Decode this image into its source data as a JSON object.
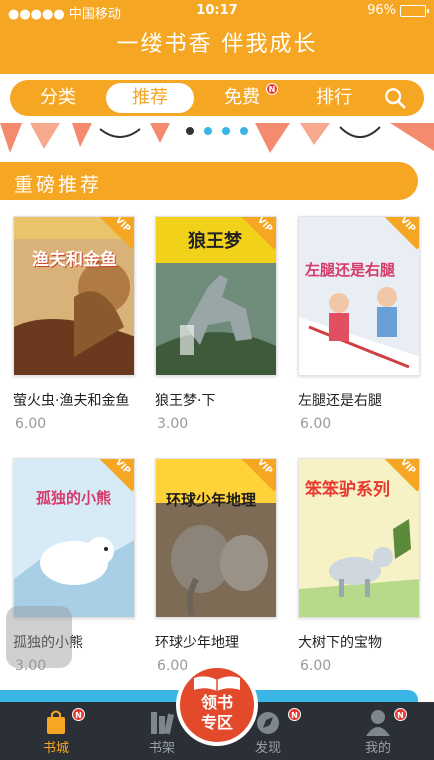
{
  "status_bar": {
    "carrier": "●●●●● 中国移动",
    "time": "10:17",
    "battery": "96%",
    "battery_level": 0.96
  },
  "header": {
    "title": "一缕书香 伴我成长"
  },
  "tabs": [
    {
      "label": "分类",
      "active": false
    },
    {
      "label": "推荐",
      "active": true
    },
    {
      "label": "免费",
      "active": false,
      "badge": "N"
    },
    {
      "label": "排行",
      "active": false
    }
  ],
  "carousel": {
    "page_count": 4,
    "active_index": 0
  },
  "section": {
    "title": "重磅推荐"
  },
  "vip_label": "VIP",
  "books": [
    {
      "title": "萤火虫·渔夫和金鱼",
      "price": "6.00",
      "cover_title": "渔夫和金鱼",
      "cover_color": "#c07a3a"
    },
    {
      "title": "狼王梦·下",
      "price": "3.00",
      "cover_title": "狼王梦",
      "cover_color": "#f2d11b"
    },
    {
      "title": "左腿还是右腿",
      "price": "6.00",
      "cover_title": "左腿还是右腿",
      "cover_color": "#dde7f0"
    },
    {
      "title": "孤独的小熊",
      "price": "3.00",
      "cover_title": "孤独的小熊",
      "cover_color": "#cfe6f4"
    },
    {
      "title": "环球少年地理",
      "price": "6.00",
      "cover_title": "环球少年地理",
      "cover_color": "#ffd23a"
    },
    {
      "title": "大树下的宝物",
      "price": "6.00",
      "cover_title": "笨笨驴系列",
      "cover_color": "#f5f1c0"
    }
  ],
  "bottom_nav": {
    "items": [
      {
        "label": "书城",
        "active": true,
        "badge": "N"
      },
      {
        "label": "书架",
        "active": false
      },
      {
        "label": "发现",
        "active": false,
        "badge": "N"
      },
      {
        "label": "我的",
        "active": false,
        "badge": "N"
      }
    ],
    "center": {
      "line1": "领书",
      "line2": "专区"
    }
  },
  "colors": {
    "brand": "#f5a623",
    "accent_blue": "#39b6e6",
    "badge": "#e8382f",
    "nav_bg": "#2a3036",
    "center_btn": "#e24a2b"
  }
}
